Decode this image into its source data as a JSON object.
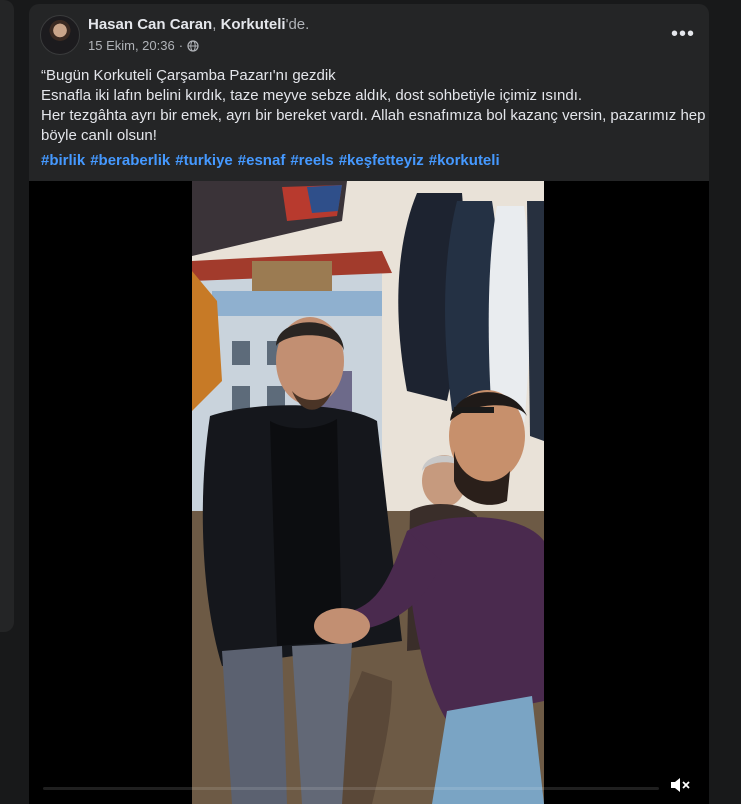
{
  "post": {
    "author": "Hasan Can Caran",
    "separator": ",",
    "place": "Korkuteli",
    "place_suffix": "'de.",
    "date": "15 Ekim, 20:36",
    "dot": "·",
    "privacy_icon": "globe-icon",
    "more_icon": "more-options-icon",
    "more_glyph": "•••",
    "text_lines": [
      "“Bugün Korkuteli Çarşamba Pazarı'nı gezdik",
      "Esnafla iki lafın belini kırdık, taze meyve sebze aldık, dost sohbetiyle içimiz ısındı.",
      "Her tezgâhta ayrı bir emek, ayrı bir bereket vardı. Allah esnafımıza bol kazanç versin, pazarımız hep",
      "böyle canlı olsun!"
    ],
    "hashtags": [
      "#birlik",
      "#beraberlik",
      "#turkiye",
      "#esnaf",
      "#reels",
      "#keşfetteyiz",
      "#korkuteli"
    ]
  },
  "video": {
    "progress": 0.0,
    "mute_icon": "speaker-muted-icon"
  },
  "colors": {
    "page_bg": "#18191a",
    "card_bg": "#242526",
    "text": "#e4e6eb",
    "secondary": "#b0b3b8",
    "hashtag": "#4599ff"
  }
}
